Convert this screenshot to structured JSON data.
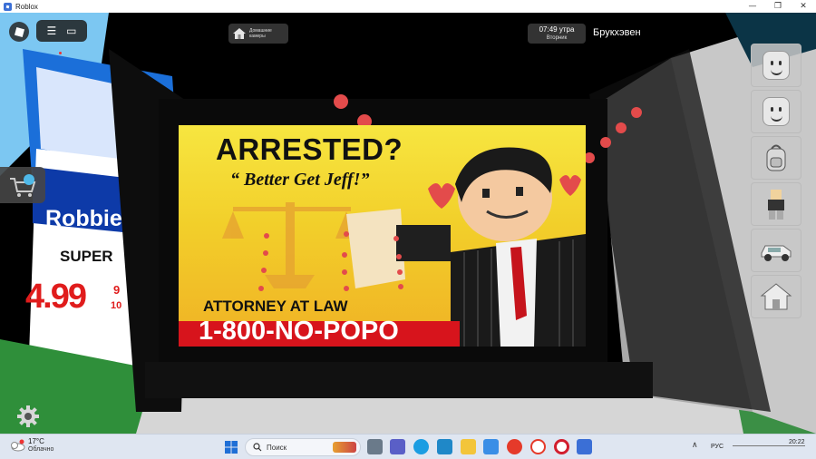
{
  "window": {
    "title": "Roblox",
    "controls": {
      "minimize": "—",
      "maximize": "❐",
      "close": "✕"
    }
  },
  "hud": {
    "roblox_menu_icon": "roblox-logo-icon",
    "menu_icons": [
      "hamburger-icon",
      "chat-icon"
    ],
    "home_button": {
      "icon": "house-icon",
      "label": "Домашние камеры"
    },
    "clock": {
      "time": "07:49 утра",
      "day": "Вторник"
    },
    "place_name": "Брукхэвен"
  },
  "billboard": {
    "headline": "ARRESTED?",
    "slogan": "“ Better Get Jeff!”",
    "subtitle": "ATTORNEY AT LAW",
    "phone": "1-800-NO-POPO",
    "colors": {
      "top": "#f7e640",
      "bottom": "#f0b125",
      "phone_bar": "#d7141c"
    }
  },
  "gas_sign": {
    "brand": "Robbie",
    "grade": "SUPER",
    "price": "4.99",
    "fraction_top": "9",
    "fraction_bottom": "10"
  },
  "right_bar": [
    {
      "icon": "smiley-face-icon"
    },
    {
      "icon": "face-edit-icon"
    },
    {
      "icon": "backpack-icon"
    },
    {
      "icon": "avatar-icon"
    },
    {
      "icon": "car-icon"
    },
    {
      "icon": "house-icon"
    }
  ],
  "left_widgets": {
    "shop": "shop-cart-icon",
    "settings": "gear-icon"
  },
  "taskbar": {
    "weather": {
      "temp": "17°C",
      "condition": "Облачно"
    },
    "search_label": "Поиск",
    "apps": [
      "task-view-icon",
      "teams-icon",
      "edge-icon",
      "store-icon",
      "explorer-icon",
      "ms-store-icon",
      "yandex-icon",
      "yandex-browser-icon",
      "opera-icon",
      "roblox-taskbar-icon"
    ],
    "tray_lang": "РУС",
    "tray_time": "20:22"
  }
}
